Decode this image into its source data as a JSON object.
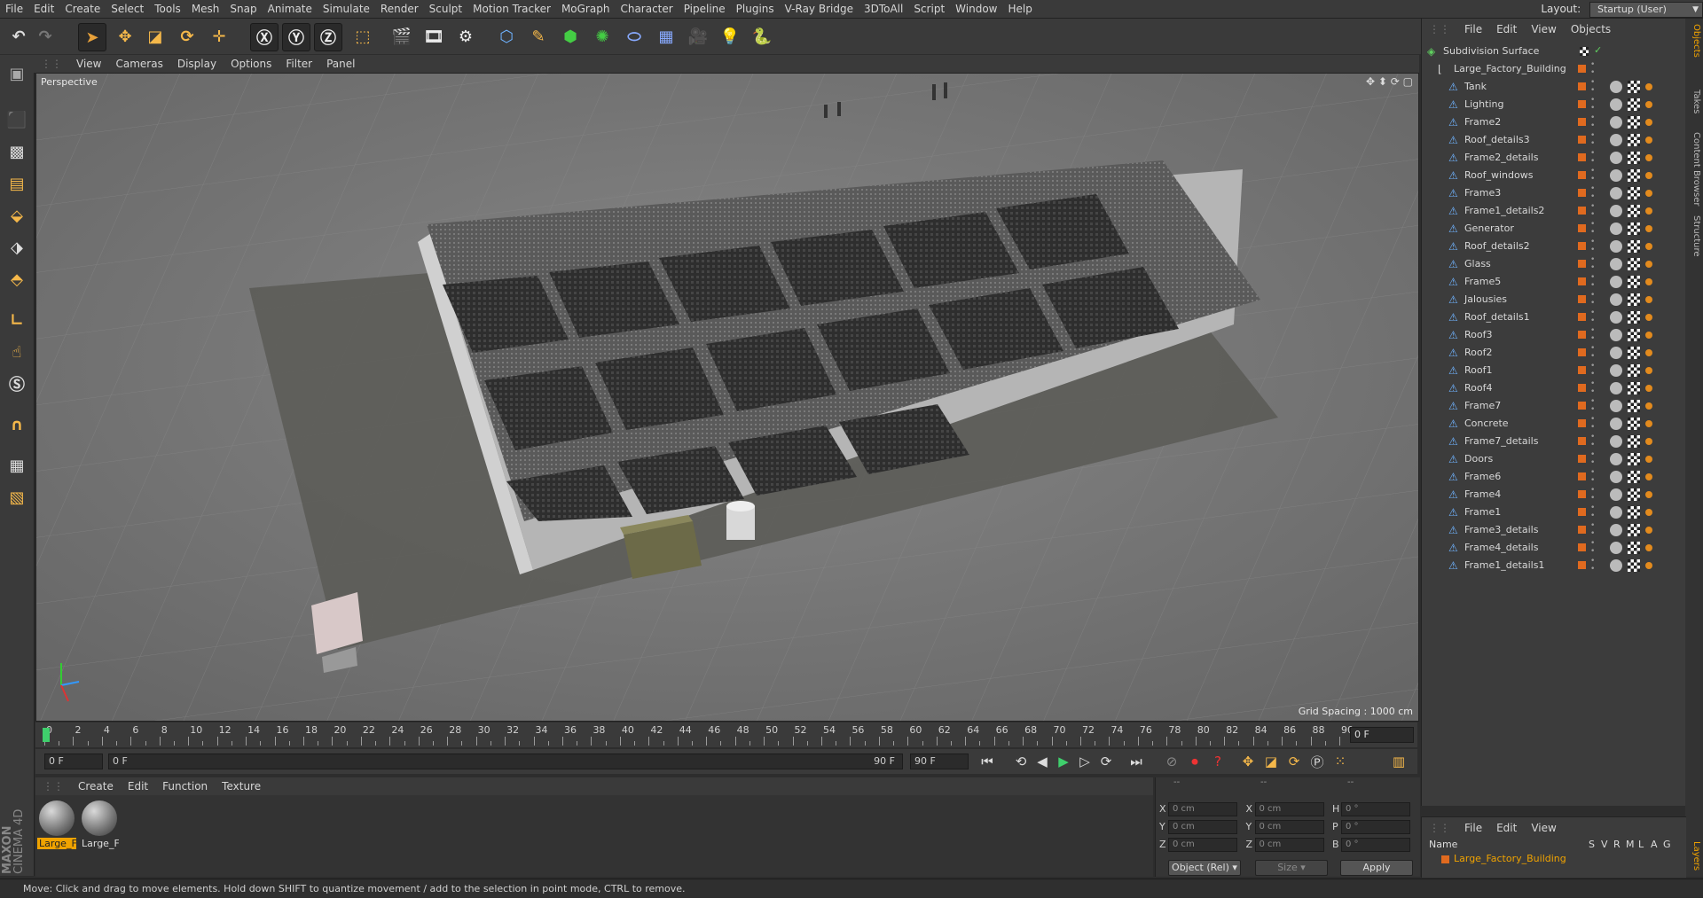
{
  "menubar": {
    "items": [
      "File",
      "Edit",
      "Create",
      "Select",
      "Tools",
      "Mesh",
      "Snap",
      "Animate",
      "Simulate",
      "Render",
      "Sculpt",
      "Motion Tracker",
      "MoGraph",
      "Character",
      "Pipeline",
      "Plugins",
      "V-Ray Bridge",
      "3DToAll",
      "Script",
      "Window",
      "Help"
    ],
    "layout_label": "Layout:",
    "layout_value": "Startup (User)"
  },
  "viewport": {
    "menu": [
      "View",
      "Cameras",
      "Display",
      "Options",
      "Filter",
      "Panel"
    ],
    "label": "Perspective",
    "grid_spacing": "Grid Spacing : 1000 cm"
  },
  "timeline": {
    "ticks": [
      0,
      2,
      4,
      6,
      8,
      10,
      12,
      14,
      16,
      18,
      20,
      22,
      24,
      26,
      28,
      30,
      32,
      34,
      36,
      38,
      40,
      42,
      44,
      46,
      48,
      50,
      52,
      54,
      56,
      58,
      60,
      62,
      64,
      66,
      68,
      70,
      72,
      74,
      76,
      78,
      80,
      82,
      84,
      86,
      88,
      90
    ],
    "current_frame": "0 F",
    "start_field": "0 F",
    "range_start": "0 F",
    "range_end": "90 F",
    "end_field": "90 F"
  },
  "materials": {
    "menu": [
      "Create",
      "Edit",
      "Function",
      "Texture"
    ],
    "items": [
      {
        "label": "Large_F",
        "selected": true
      },
      {
        "label": "Large_F",
        "selected": false
      }
    ]
  },
  "coordinates": {
    "headers": [
      "--",
      "--",
      "--"
    ],
    "rows": [
      {
        "l1": "X",
        "v1": "0 cm",
        "l2": "X",
        "v2": "0 cm",
        "l3": "H",
        "v3": "0 °"
      },
      {
        "l1": "Y",
        "v1": "0 cm",
        "l2": "Y",
        "v2": "0 cm",
        "l3": "P",
        "v3": "0 °"
      },
      {
        "l1": "Z",
        "v1": "0 cm",
        "l2": "Z",
        "v2": "0 cm",
        "l3": "B",
        "v3": "0 °"
      }
    ],
    "mode": "Object (Rel)",
    "size": "Size",
    "apply": "Apply"
  },
  "status": {
    "text": "Move: Click and drag to move elements. Hold down SHIFT to quantize movement / add to the selection in point mode, CTRL to remove."
  },
  "logo": {
    "brand": "MAXON",
    "product": "CINEMA 4D"
  },
  "objects": {
    "menu": [
      "File",
      "Edit",
      "View",
      "Objects"
    ],
    "root": "Subdivision Surface",
    "parent": "Large_Factory_Building",
    "children": [
      "Tank",
      "Lighting",
      "Frame2",
      "Roof_details3",
      "Frame2_details",
      "Roof_windows",
      "Frame3",
      "Frame1_details2",
      "Generator",
      "Roof_details2",
      "Glass",
      "Frame5",
      "Jalousies",
      "Roof_details1",
      "Roof3",
      "Roof2",
      "Roof1",
      "Roof4",
      "Frame7",
      "Concrete",
      "Frame7_details",
      "Doors",
      "Frame6",
      "Frame4",
      "Frame1",
      "Frame3_details",
      "Frame4_details",
      "Frame1_details1"
    ]
  },
  "right_tabs": [
    "Objects",
    "Takes",
    "Content Browser",
    "Structure",
    "Layers"
  ],
  "layers": {
    "menu": [
      "File",
      "Edit",
      "View"
    ],
    "columns": [
      "Name",
      "S",
      "V",
      "R",
      "M",
      "L",
      "A",
      "G"
    ],
    "row": "Large_Factory_Building"
  },
  "colors": {
    "accent": "#f0a300",
    "tag": "#e06a1f",
    "axis_x": "#d33",
    "axis_y": "#3c3",
    "axis_z": "#39f"
  }
}
